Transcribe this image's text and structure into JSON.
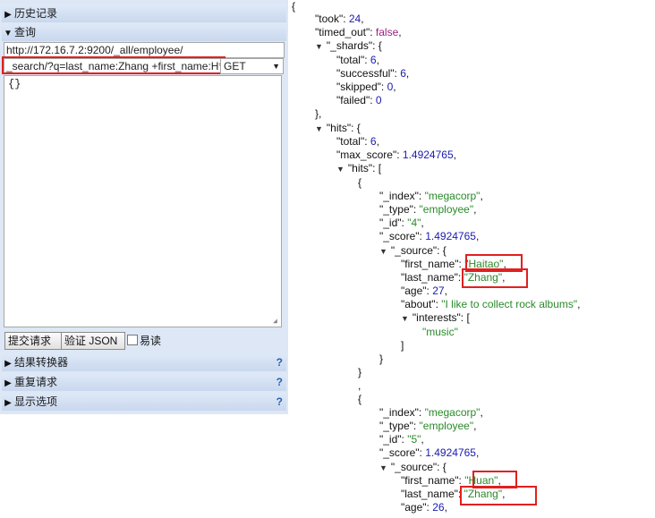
{
  "left": {
    "history_label": "历史记录",
    "query_label": "查询",
    "url": "http://172.16.7.2:9200/_all/employee/",
    "path": "_search/?q=last_name:Zhang +first_name:H*",
    "method": "GET",
    "body": "{}",
    "submit_label": "提交请求",
    "validate_label": "验证 JSON",
    "pretty_label": "易读",
    "result_transformer_label": "结果转换器",
    "repeat_label": "重复请求",
    "display_options_label": "显示选项",
    "help_glyph": "?"
  },
  "json": {
    "open": "{",
    "took": [
      "\"took\"",
      ": ",
      "24",
      ","
    ],
    "timed_out": [
      "\"timed_out\"",
      ": ",
      "false",
      ","
    ],
    "shards": [
      "\"_shards\"",
      ": {"
    ],
    "total6": [
      "\"total\"",
      ": ",
      "6",
      ","
    ],
    "successful": [
      "\"successful\"",
      ": ",
      "6",
      ","
    ],
    "skipped": [
      "\"skipped\"",
      ": ",
      "0",
      ","
    ],
    "failed": [
      "\"failed\"",
      ": ",
      "0"
    ],
    "close_shards": "},",
    "hits": [
      "\"hits\"",
      ": {"
    ],
    "htotal": [
      "\"total\"",
      ": ",
      "6",
      ","
    ],
    "max_score": [
      "\"max_score\"",
      ": ",
      "1.4924765",
      ","
    ],
    "hits_arr": [
      "\"hits\"",
      ": ["
    ],
    "obj1_open": "{",
    "index1": [
      "\"_index\"",
      ": ",
      "\"megacorp\"",
      ","
    ],
    "type1": [
      "\"_type\"",
      ": ",
      "\"employee\"",
      ","
    ],
    "id1": [
      "\"_id\"",
      ": ",
      "\"4\"",
      ","
    ],
    "score1": [
      "\"_score\"",
      ": ",
      "1.4924765",
      ","
    ],
    "source1": [
      "\"_source\"",
      ": {"
    ],
    "fn1": [
      "\"first_name\"",
      ": ",
      "\"Haitao\"",
      ","
    ],
    "ln1": [
      "\"last_name\"",
      ": ",
      "\"Zhang\"",
      ","
    ],
    "age1": [
      "\"age\"",
      ": ",
      "27",
      ","
    ],
    "about1": [
      "\"about\"",
      ": ",
      "\"I like to collect rock albums\"",
      ","
    ],
    "interests1": [
      "\"interests\"",
      ": ["
    ],
    "music": "\"music\"",
    "close_arr": "]",
    "close_src1": "}",
    "close_obj1": "}",
    "comma": ",",
    "obj2_open": "{",
    "index2": [
      "\"_index\"",
      ": ",
      "\"megacorp\"",
      ","
    ],
    "type2": [
      "\"_type\"",
      ": ",
      "\"employee\"",
      ","
    ],
    "id2": [
      "\"_id\"",
      ": ",
      "\"5\"",
      ","
    ],
    "score2": [
      "\"_score\"",
      ": ",
      "1.4924765",
      ","
    ],
    "source2": [
      "\"_source\"",
      ": {"
    ],
    "fn2": [
      "\"first_name\"",
      ": ",
      "\"Huan\"",
      ","
    ],
    "ln2": [
      "\"last_name\"",
      ": ",
      "\"Zhang\"",
      ","
    ],
    "age2": [
      "\"age\"",
      ": ",
      "26",
      ","
    ]
  }
}
